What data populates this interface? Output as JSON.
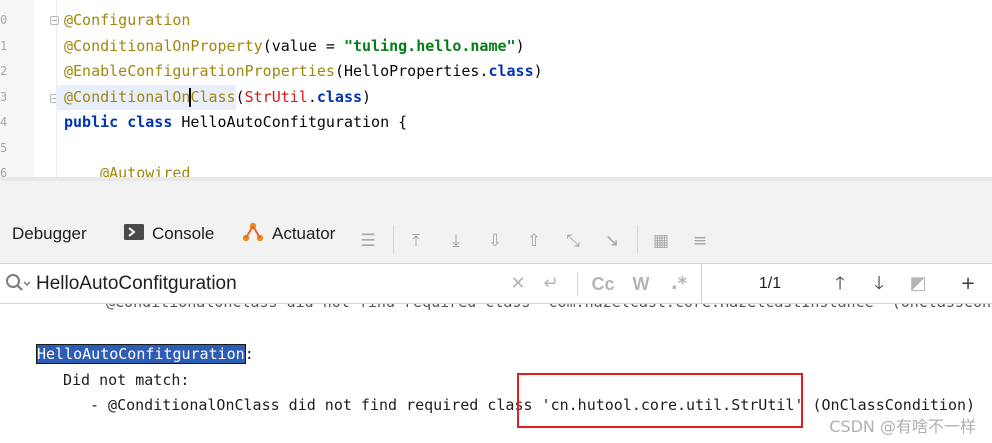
{
  "editor": {
    "line_numbers": [
      "0",
      "1",
      "2",
      "3",
      "4",
      "5",
      "6"
    ],
    "lines": [
      {
        "annotation": "@Configuration"
      },
      {
        "annotation": "@ConditionalOnProperty",
        "open": "(value = ",
        "string": "\"tuling.hello.name\"",
        "close": ")"
      },
      {
        "annotation": "@EnableConfigurationProperties",
        "open": "(HelloProperties.",
        "keyword": "class",
        "close": ")"
      },
      {
        "annotation_a": "@ConditionalOn",
        "annotation_b": "Class",
        "open": "(",
        "class_ref": "StrUtil",
        "dot": ".",
        "keyword": "class",
        "close": ")"
      },
      {
        "kw1": "public",
        "kw2": "class",
        "name": " HelloAutoConfitguration {"
      },
      {
        "text": ""
      },
      {
        "annotation": "    @Autowired"
      }
    ]
  },
  "tabs": [
    {
      "label": "Debugger",
      "icon": "none"
    },
    {
      "label": "Console",
      "icon": "console-icon"
    },
    {
      "label": "Actuator",
      "icon": "actuator-icon"
    }
  ],
  "search": {
    "value": "HelloAutoConfitguration",
    "match_count": "1/1",
    "icons": [
      "search-options-icon",
      "clear-icon",
      "new-line-icon",
      "match-case-icon",
      "words-icon",
      "regex-icon",
      "previous-occurrence-icon",
      "next-occurrence-icon",
      "filter-icon",
      "add-selection-icon"
    ],
    "match_case_label": "Cc",
    "words_label": "W",
    "regex_label": ".*"
  },
  "console": {
    "cut_line": "@ConditionalOnClass did not find required class 'com.hazelcast.core.HazelcastInstance' (OnClassCon",
    "match_name": "HelloAutoConfitguration",
    "match_suffix": ":",
    "did_not_match": "Did not match:",
    "detail_prefix": "- @ConditionalOnClass did not find required class ",
    "detail_class": "'cn.hutool.core.util.StrUtil'",
    "detail_suffix": " (OnClassCondition)"
  },
  "watermark": "CSDN @有啥不一样",
  "colors": {
    "annotation": "#9e880d",
    "string": "#067d17",
    "keyword": "#0033b3",
    "class_ref": "#d61a1a",
    "highlight_box": "#e02020",
    "search_match": "#2d5db5"
  }
}
